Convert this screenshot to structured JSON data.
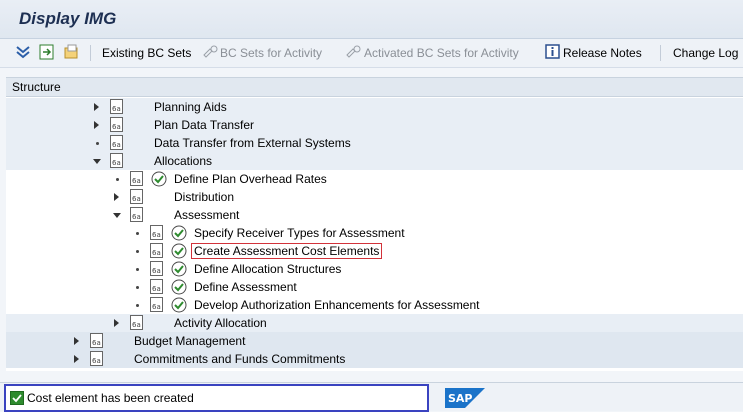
{
  "window": {
    "title": "Display IMG"
  },
  "toolbar": {
    "existing_bc_sets": "Existing BC Sets",
    "bc_sets_for_activity": "BC Sets for Activity",
    "activated_bc_sets_for_activity": "Activated BC Sets for Activity",
    "release_notes": "Release Notes",
    "change_log": "Change Log"
  },
  "tree": {
    "header": "Structure",
    "items": [
      {
        "label": "Planning Aids"
      },
      {
        "label": "Plan Data Transfer"
      },
      {
        "label": "Data Transfer from External Systems"
      },
      {
        "label": "Allocations"
      },
      {
        "label": "Define Plan Overhead Rates"
      },
      {
        "label": "Distribution"
      },
      {
        "label": "Assessment"
      },
      {
        "label": "Specify Receiver Types for Assessment"
      },
      {
        "label": "Create Assessment Cost Elements"
      },
      {
        "label": "Define Allocation Structures"
      },
      {
        "label": "Define Assessment"
      },
      {
        "label": "Develop Authorization Enhancements for Assessment"
      },
      {
        "label": "Activity Allocation"
      },
      {
        "label": "Budget Management"
      },
      {
        "label": "Commitments and Funds Commitments"
      }
    ]
  },
  "status": {
    "message": "Cost element has been created"
  },
  "colors": {
    "status_border": "#3a43c0",
    "selection_outline": "#d2323a",
    "title_text": "#1d2f52"
  }
}
